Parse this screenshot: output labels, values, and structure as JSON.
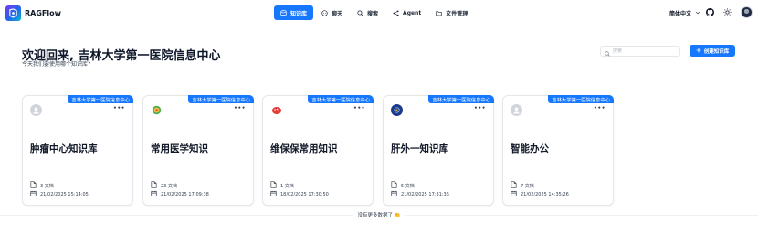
{
  "header": {
    "app_name": "RAGFlow",
    "nav": [
      {
        "label": "知识库",
        "icon": "database-icon",
        "active": true
      },
      {
        "label": "聊天",
        "icon": "chat-bubble-icon",
        "active": false
      },
      {
        "label": "搜索",
        "icon": "search-icon",
        "active": false
      },
      {
        "label": "Agent",
        "icon": "agent-graph-icon",
        "active": false
      },
      {
        "label": "文件管理",
        "icon": "folder-icon",
        "active": false
      }
    ],
    "language": "简体中文",
    "github_icon": "github-icon",
    "theme_icon": "sun-icon"
  },
  "main": {
    "title": "欢迎回来, 吉林大学第一医院信息中心",
    "subtitle": "今天我们要使用哪个知识库?",
    "search_placeholder": "搜索",
    "create_label": "创建知识库"
  },
  "knowledge_bases": [
    {
      "owner": "吉林大学第一医院信息中心",
      "name": "肿瘤中心知识库",
      "docs": "3 文档",
      "time": "21/02/2025 15:14:05",
      "avatar": "default-user-icon"
    },
    {
      "owner": "吉林大学第一医院信息中心",
      "name": "常用医学知识",
      "docs": "23 文档",
      "time": "21/02/2025 17:09:38",
      "avatar": "green-badge-icon"
    },
    {
      "owner": "吉林大学第一医院信息中心",
      "name": "维保保常用知识",
      "docs": "1 文档",
      "time": "18/02/2025 17:30:50",
      "avatar": "red-piggy-icon"
    },
    {
      "owner": "吉林大学第一医院信息中心",
      "name": "肝外一知识库",
      "docs": "5 文档",
      "time": "21/02/2025 17:31:36",
      "avatar": "navy-emblem-icon"
    },
    {
      "owner": "吉林大学第一医院信息中心",
      "name": "智能办公",
      "docs": "7 文档",
      "time": "21/02/2025 14:35:26",
      "avatar": "default-user-icon"
    }
  ],
  "footer": {
    "no_more": "没有更多数据了 👏"
  },
  "colors": {
    "accent": "#1677ff"
  }
}
